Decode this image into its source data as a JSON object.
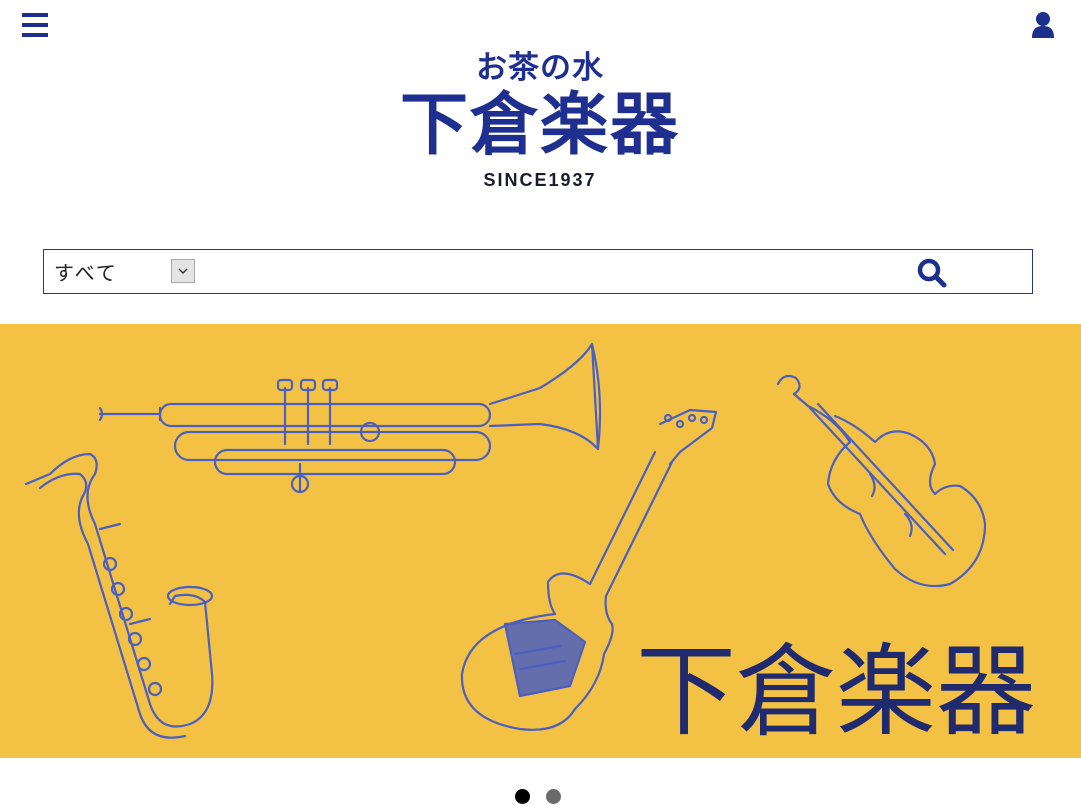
{
  "header": {
    "menu_icon": "hamburger-menu-icon",
    "account_icon": "user-icon"
  },
  "logo": {
    "subtitle": "お茶の水",
    "name": "下倉楽器",
    "since": "SINCE1937"
  },
  "search": {
    "category_selected": "すべて",
    "dropdown_icon": "chevron-down-icon",
    "input_value": "",
    "submit_icon": "search-icon"
  },
  "banner": {
    "title": "下倉楽器",
    "illustrations": [
      "trumpet",
      "saxophone",
      "electric-guitar",
      "violin"
    ],
    "background_color": "#f3c244",
    "line_color": "#4a5fc0",
    "title_color": "#1f2b6e"
  },
  "carousel": {
    "slides": 2,
    "active_slide": 1
  },
  "colors": {
    "brand_blue": "#1f2f8f",
    "border_blue": "#1f3a8a"
  }
}
